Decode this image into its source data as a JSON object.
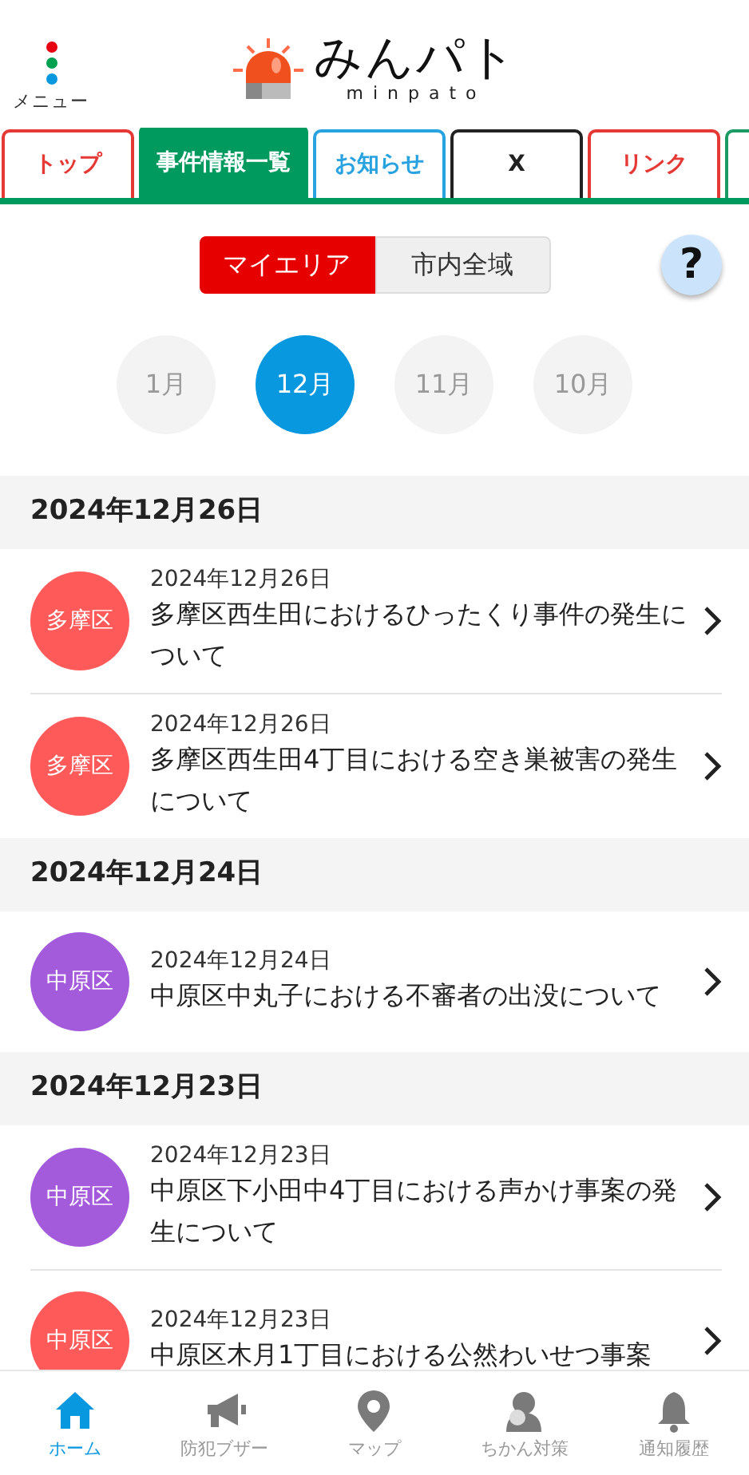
{
  "header": {
    "menu_label": "メニュー",
    "logo_title": "みんパト",
    "logo_subtitle": "minpato"
  },
  "tabs": [
    {
      "label": "トップ",
      "color": "#e53935",
      "selected": false
    },
    {
      "label": "事件情報一覧",
      "color": "#009a5e",
      "selected": true
    },
    {
      "label": "お知らせ",
      "color": "#29a3e0",
      "selected": false
    },
    {
      "label": "X",
      "color": "#222222",
      "selected": false
    },
    {
      "label": "リンク",
      "color": "#e53935",
      "selected": false
    },
    {
      "color": "#1a9b63",
      "selected": false
    }
  ],
  "area_toggle": [
    {
      "label": "マイエリア",
      "selected": true
    },
    {
      "label": "市内全域",
      "selected": false
    }
  ],
  "help_button": {
    "label": "?"
  },
  "months": [
    {
      "label": "1月",
      "selected": false
    },
    {
      "label": "12月",
      "selected": true
    },
    {
      "label": "11月",
      "selected": false
    },
    {
      "label": "10月",
      "selected": false
    }
  ],
  "sections": [
    {
      "date": "2024年12月26日",
      "items": [
        {
          "district": "多摩区",
          "color": "#ff5a5a",
          "date": "2024年12月26日",
          "title": "多摩区西生田におけるひったくり事件の発生について"
        },
        {
          "district": "多摩区",
          "color": "#ff5a5a",
          "date": "2024年12月26日",
          "title": "多摩区西生田4丁目における空き巣被害の発生について"
        }
      ]
    },
    {
      "date": "2024年12月24日",
      "items": [
        {
          "district": "中原区",
          "color": "#a35bdc",
          "date": "2024年12月24日",
          "title": "中原区中丸子における不審者の出没について"
        }
      ]
    },
    {
      "date": "2024年12月23日",
      "items": [
        {
          "district": "中原区",
          "color": "#a35bdc",
          "date": "2024年12月23日",
          "title": "中原区下小田中4丁目における声かけ事案の発生について"
        },
        {
          "district": "中原区",
          "color": "#ff5a5a",
          "date": "2024年12月23日",
          "title": "中原区木月1丁目における公然わいせつ事案"
        }
      ]
    }
  ],
  "bottom_nav": [
    {
      "kind": "home",
      "label": "ホーム",
      "selected": true
    },
    {
      "kind": "buzzer",
      "label": "防犯ブザー",
      "selected": false
    },
    {
      "kind": "map",
      "label": "マップ",
      "selected": false
    },
    {
      "kind": "molester",
      "label": "ちかん対策",
      "selected": false
    },
    {
      "kind": "bell",
      "label": "通知履歴",
      "selected": false
    }
  ]
}
